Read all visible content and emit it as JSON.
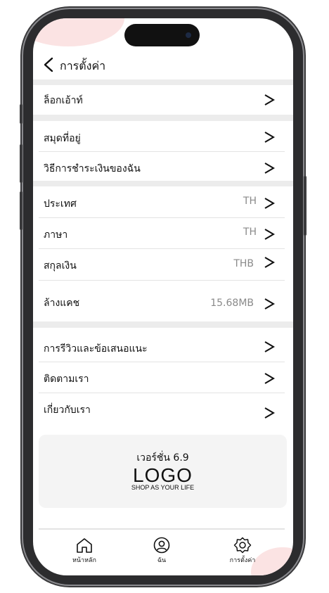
{
  "header": {
    "title": "การตั้งค่า",
    "back_icon": "chevron-left-icon"
  },
  "settings": {
    "logout": {
      "label": "ล็อกเอ้าท์"
    },
    "address_book": {
      "label": "สมุดที่อยู่"
    },
    "payment_methods": {
      "label": "วิธีการชำระเงินของฉัน"
    },
    "country": {
      "label": "ประเทศ",
      "value": "TH"
    },
    "language": {
      "label": "ภาษา",
      "value": "TH"
    },
    "currency": {
      "label": "สกุลเงิน",
      "value": "THB"
    },
    "clear_cache": {
      "label": "ล้างแคช",
      "value": "15.68MB"
    },
    "reviews_feedback": {
      "label": "การรีวิวและข้อเสนอแนะ"
    },
    "follow_us": {
      "label": "ติดตามเรา"
    },
    "about_us": {
      "label": "เกี่ยวกับเรา"
    },
    "chevron": ">"
  },
  "version_card": {
    "version": "เวอร์ชั่น 6.9",
    "logo": "LOGO",
    "slogan": "SHOP AS YOUR LIFE"
  },
  "tabbar": {
    "tabs": [
      {
        "label": "หน้าหลัก",
        "icon": "home-icon"
      },
      {
        "label": "ฉัน",
        "icon": "user-icon"
      },
      {
        "label": "การตั้งค่า",
        "icon": "gear-icon"
      }
    ]
  },
  "colors": {
    "accent_blob": "#fbe3e3",
    "separator": "#ececec",
    "muted_text": "#8a8a8a"
  }
}
